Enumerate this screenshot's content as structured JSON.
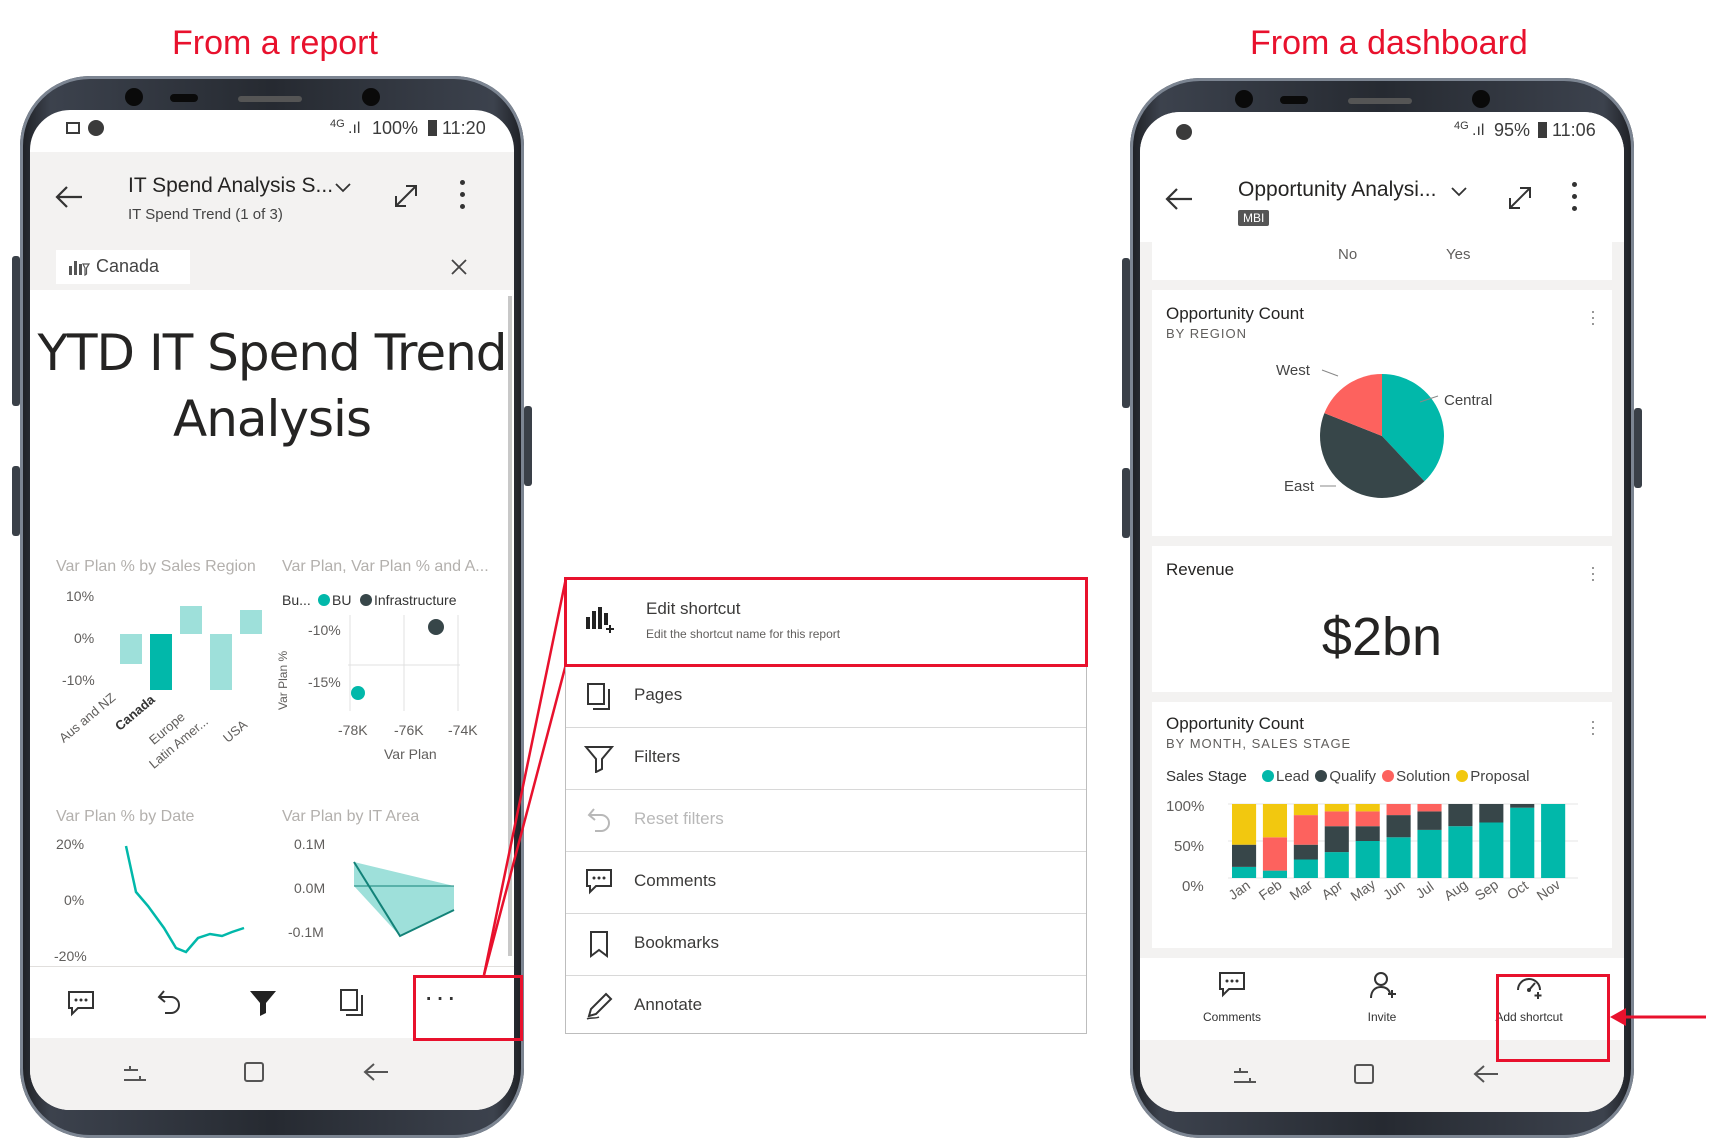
{
  "captions": {
    "left": "From a report",
    "right": "From a dashboard"
  },
  "left_phone": {
    "status": {
      "time": "11:20",
      "battery": "100%",
      "network": "4G"
    },
    "header": {
      "title": "IT Spend Analysis S...",
      "subtitle": "IT Spend Trend (1 of 3)"
    },
    "filter_chip": "Canada",
    "report_title_line1": "YTD IT Spend Trend",
    "report_title_line2": "Analysis",
    "chart1": {
      "title": "Var Plan % by Sales Region",
      "yticks": [
        "10%",
        "0%",
        "-10%"
      ],
      "xticks": [
        "Aus and NZ",
        "Canada",
        "Europe",
        "Latin Amer...",
        "USA"
      ]
    },
    "chart2": {
      "title": "Var Plan, Var Plan % and A...",
      "legend_prefix": "Bu...",
      "legend": [
        "BU",
        "Infrastructure"
      ],
      "yticks": [
        "-10%",
        "-15%"
      ],
      "xticks": [
        "-78K",
        "-76K",
        "-74K"
      ],
      "ylabel": "Var Plan %",
      "xlabel": "Var Plan"
    },
    "chart3": {
      "title": "Var Plan % by Date",
      "yticks": [
        "20%",
        "0%",
        "-20%"
      ]
    },
    "chart4": {
      "title": "Var Plan by IT Area",
      "yticks": [
        "0.1M",
        "0.0M",
        "-0.1M"
      ]
    },
    "toolbar_icons": [
      "comment-icon",
      "undo-icon",
      "filter-icon",
      "pages-icon",
      "more-icon"
    ],
    "toolbar_more": "···"
  },
  "menu": {
    "items": [
      {
        "label": "Edit shortcut",
        "desc": "Edit the shortcut name for this report"
      },
      {
        "label": "Pages"
      },
      {
        "label": "Filters"
      },
      {
        "label": "Reset filters"
      },
      {
        "label": "Comments"
      },
      {
        "label": "Bookmarks"
      },
      {
        "label": "Annotate"
      }
    ]
  },
  "right_phone": {
    "status": {
      "time": "11:06",
      "battery": "95%",
      "network": "4G"
    },
    "header": {
      "title": "Opportunity Analysi...",
      "badge": "MBI"
    },
    "top_labels": [
      "No",
      "Yes"
    ],
    "tile1": {
      "title": "Opportunity Count",
      "subtitle": "BY REGION",
      "chart_data": {
        "type": "pie",
        "labels": [
          "Central",
          "East",
          "West"
        ],
        "values": [
          38,
          43,
          19
        ],
        "colors": [
          "#01b8aa",
          "#374649",
          "#fd625e"
        ]
      }
    },
    "tile2": {
      "title": "Revenue",
      "value": "$2bn"
    },
    "tile3": {
      "title": "Opportunity Count",
      "subtitle": "BY MONTH, SALES STAGE",
      "legend_title": "Sales Stage",
      "chart_data": {
        "type": "bar",
        "stacked": "100%",
        "categories": [
          "Jan",
          "Feb",
          "Mar",
          "Apr",
          "May",
          "Jun",
          "Jul",
          "Aug",
          "Sep",
          "Oct",
          "Nov"
        ],
        "series": [
          {
            "name": "Lead",
            "color": "#01b8aa",
            "values": [
              15,
              10,
              25,
              35,
              50,
              55,
              65,
              70,
              75,
              95,
              100
            ]
          },
          {
            "name": "Qualify",
            "color": "#374649",
            "values": [
              30,
              0,
              20,
              35,
              20,
              30,
              25,
              30,
              25,
              5,
              0
            ]
          },
          {
            "name": "Solution",
            "color": "#fd625e",
            "values": [
              0,
              45,
              40,
              20,
              20,
              15,
              10,
              0,
              0,
              0,
              0
            ]
          },
          {
            "name": "Proposal",
            "color": "#f2c80f",
            "values": [
              55,
              45,
              15,
              10,
              10,
              0,
              0,
              0,
              0,
              0,
              0
            ]
          }
        ],
        "yticks": [
          "100%",
          "50%",
          "0%"
        ],
        "ylim": [
          0,
          100
        ]
      }
    },
    "bottom": {
      "comments": "Comments",
      "invite": "Invite",
      "add_shortcut": "Add shortcut"
    }
  }
}
